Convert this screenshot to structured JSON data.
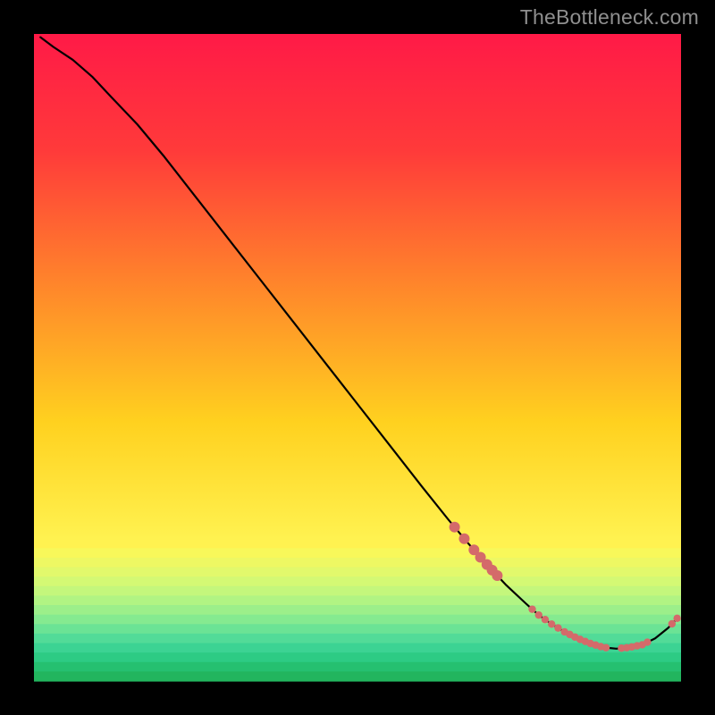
{
  "watermark": "TheBottleneck.com",
  "chart_data": {
    "type": "line",
    "title": "",
    "xlabel": "",
    "ylabel": "",
    "xlim": [
      0,
      100
    ],
    "ylim": [
      0,
      100
    ],
    "grid": false,
    "legend": false,
    "x": [
      1,
      3,
      6,
      9,
      12,
      16,
      20,
      25,
      30,
      35,
      40,
      45,
      50,
      55,
      60,
      64,
      67,
      70,
      73,
      76,
      78,
      80,
      82,
      84,
      86,
      88,
      90,
      92,
      94,
      96,
      98,
      99.5
    ],
    "values": [
      99.5,
      98.0,
      96.0,
      93.4,
      90.2,
      86.0,
      81.2,
      74.8,
      68.4,
      62.0,
      55.6,
      49.2,
      42.8,
      36.4,
      30.0,
      25.0,
      21.4,
      18.0,
      14.8,
      12.0,
      10.2,
      8.8,
      7.6,
      6.6,
      5.8,
      5.2,
      5.0,
      5.2,
      5.6,
      6.6,
      8.2,
      9.8
    ],
    "markers": {
      "color": "#d46a6a",
      "x": [
        65.0,
        66.5,
        68.0,
        69.0,
        70.0,
        70.8,
        71.6,
        77.0,
        78.0,
        79.0,
        80.0,
        81.0,
        82.0,
        82.8,
        83.6,
        84.4,
        85.2,
        86.0,
        86.8,
        87.6,
        88.4,
        90.8,
        91.6,
        92.4,
        93.2,
        94.0,
        94.8,
        98.6,
        99.4
      ],
      "radius_first_group": 6.0,
      "radius_rest": 4.2
    },
    "gradient_stops": [
      {
        "pct": 0.0,
        "color": "#ff1a47"
      },
      {
        "pct": 18.0,
        "color": "#ff3a3a"
      },
      {
        "pct": 40.0,
        "color": "#ff8a2a"
      },
      {
        "pct": 60.0,
        "color": "#ffd11f"
      },
      {
        "pct": 78.0,
        "color": "#fff250"
      },
      {
        "pct": 88.0,
        "color": "#e9ff7a"
      },
      {
        "pct": 95.0,
        "color": "#8ff59a"
      },
      {
        "pct": 100.0,
        "color": "#2bd87b"
      }
    ],
    "band_start_pct": 78.0,
    "bands": [
      "#fff250",
      "#f8f85a",
      "#eef863",
      "#e2f96c",
      "#d4f974",
      "#c4f77c",
      "#b1f483",
      "#9cef8a",
      "#85ea90",
      "#6be395",
      "#52db98",
      "#3cd393",
      "#2dcb84",
      "#25c070",
      "#22b55e"
    ]
  }
}
